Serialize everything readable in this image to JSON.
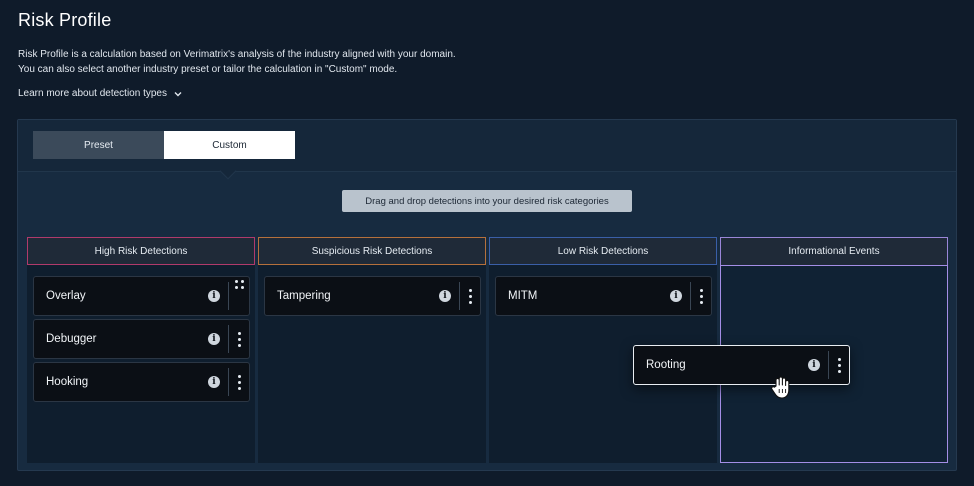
{
  "header": {
    "title": "Risk Profile",
    "description_line1": "Risk Profile is a calculation based on Verimatrix's analysis of the industry aligned with your domain.",
    "description_line2": "You can also select another industry preset or tailor the calculation in \"Custom\" mode.",
    "learn_more": "Learn more about detection types"
  },
  "tabs": [
    {
      "label": "Preset",
      "selected": false
    },
    {
      "label": "Custom",
      "selected": true
    }
  ],
  "hint": "Drag and drop detections into your desired risk categories",
  "columns": {
    "high": {
      "title": "High Risk Detections",
      "color": "#b03a6b",
      "items": [
        "Overlay",
        "Debugger",
        "Hooking"
      ]
    },
    "suspicious": {
      "title": "Suspicious Risk Detections",
      "color": "#b5703c",
      "items": [
        "Tampering"
      ]
    },
    "low": {
      "title": "Low Risk Detections",
      "color": "#3a5fa8",
      "items": [
        "MITM"
      ]
    },
    "informational": {
      "title": "Informational Events",
      "color": "#a48ee6",
      "items": []
    }
  },
  "dragging_item": {
    "label": "Rooting"
  },
  "icons": {
    "info": "info-icon",
    "menu": "kebab-menu-icon",
    "drag": "drag-handle-icon",
    "cursor": "hand-grab-cursor-icon",
    "chevron": "chevron-down-icon"
  }
}
